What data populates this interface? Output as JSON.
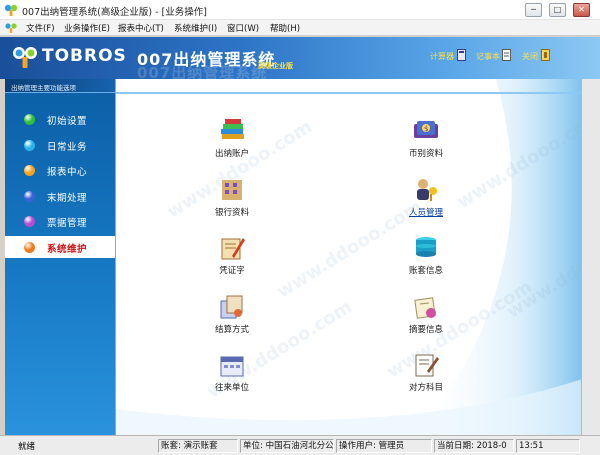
{
  "window": {
    "title": "007出纳管理系统(高级企业版) - [业务操作]",
    "controls": {
      "minimize": "─",
      "maximize": "□",
      "close": "✕"
    }
  },
  "menu": [
    "文件(F)",
    "业务操作(E)",
    "报表中心(T)",
    "系统维护(I)",
    "窗口(W)",
    "帮助(H)"
  ],
  "banner": {
    "brand": "TOBROS",
    "app_name": "007出纳管理系统",
    "edition": "高级企业版",
    "tools": [
      "计算器",
      "记事本",
      "关闭"
    ],
    "colors": {
      "gradient_start": "#1a4f9a",
      "gradient_end": "#8cc8f3",
      "accent_text": "#ffe04a"
    }
  },
  "sidebar": {
    "header": "出纳管理主要功能选项",
    "items": [
      {
        "label": "初始设置",
        "color": "#2fbf3a"
      },
      {
        "label": "日常业务",
        "color": "#27b3e8"
      },
      {
        "label": "报表中心",
        "color": "#f2a31f"
      },
      {
        "label": "末期处理",
        "color": "#3a62d6"
      },
      {
        "label": "票据管理",
        "color": "#b24cd1"
      },
      {
        "label": "系统维护",
        "color": "#f07a1e"
      }
    ],
    "active_index": 5,
    "active_color": "#d01010"
  },
  "functions": [
    {
      "label": "出纳账户",
      "icon": "books-icon"
    },
    {
      "label": "币别资料",
      "icon": "currency-icon"
    },
    {
      "label": "银行资料",
      "icon": "bank-building-icon"
    },
    {
      "label": "人员管理",
      "icon": "user-key-icon"
    },
    {
      "label": "凭证字",
      "icon": "voucher-pen-icon"
    },
    {
      "label": "账套信息",
      "icon": "database-stack-icon"
    },
    {
      "label": "结算方式",
      "icon": "settlement-papers-icon"
    },
    {
      "label": "摘要信息",
      "icon": "summary-notes-icon"
    },
    {
      "label": "往来单位",
      "icon": "company-calendar-icon"
    },
    {
      "label": "对方科目",
      "icon": "document-pen-icon"
    }
  ],
  "watermark": "www.ddooo.com",
  "status": {
    "ready": "就绪",
    "account_set_label": "账套:",
    "account_set": "演示账套",
    "unit_label": "单位:",
    "unit": "中国石油河北分公",
    "operator_label": "操作用户:",
    "operator": "管理员",
    "date_label": "当前日期:",
    "date": "2018-0",
    "time": "13:51"
  }
}
